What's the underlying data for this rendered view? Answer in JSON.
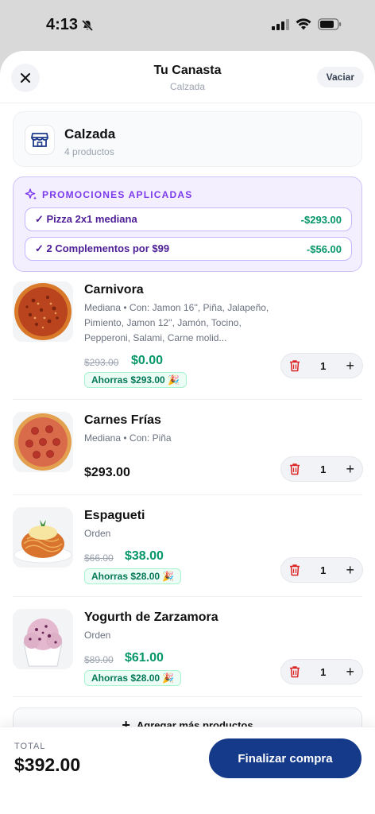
{
  "status": {
    "time": "4:13"
  },
  "header": {
    "title": "Tu Canasta",
    "subtitle": "Calzada",
    "clear_label": "Vaciar"
  },
  "store": {
    "name": "Calzada",
    "count": "4 productos"
  },
  "promos": {
    "title": "PROMOCIONES APLICADAS",
    "items": [
      {
        "label": "✓ Pizza 2x1 mediana",
        "amount": "-$293.00"
      },
      {
        "label": "✓ 2 Complementos por $99",
        "amount": "-$56.00"
      }
    ]
  },
  "items": [
    {
      "name": "Carnivora",
      "desc": "Mediana • Con: Jamon 16'', Piña, Jalapeño, Pimiento, Jamon 12'', Jamón, Tocino, Pepperoni, Salami, Carne molid...",
      "old_price": "$293.00",
      "price": "$0.00",
      "savings": "Ahorras $293.00 🎉",
      "qty": "1"
    },
    {
      "name": "Carnes Frías",
      "desc": "Mediana • Con: Piña",
      "price": "$293.00",
      "qty": "1"
    },
    {
      "name": "Espagueti",
      "desc": "Orden",
      "old_price": "$66.00",
      "price": "$38.00",
      "savings": "Ahorras $28.00 🎉",
      "qty": "1"
    },
    {
      "name": "Yogurth de Zarzamora",
      "desc": "Orden",
      "old_price": "$89.00",
      "price": "$61.00",
      "savings": "Ahorras $28.00 🎉",
      "qty": "1"
    }
  ],
  "add_more_label": "Agregar más productos",
  "footer": {
    "total_label": "TOTAL",
    "total_value": "$392.00",
    "checkout_label": "Finalizar compra"
  },
  "colors": {
    "brand": "#163a8a",
    "promo": "#7c3aed",
    "savings": "#059669",
    "delete": "#dc2626"
  }
}
